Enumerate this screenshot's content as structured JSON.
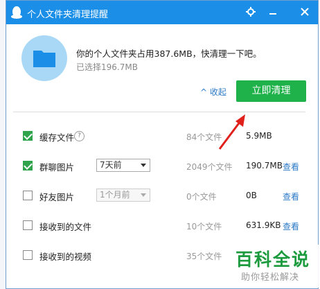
{
  "window": {
    "title": "个人文件夹清理提醒",
    "gear_icon": "gear-icon",
    "minimize_icon": "minimize-icon",
    "close_icon": "close-icon"
  },
  "summary": {
    "main_text": "你的个人文件夹占用387.6MB，快清理一下吧。",
    "selected_text": "已选择196.7MB"
  },
  "actions": {
    "collapse_label": "收起",
    "clean_label": "立即清理"
  },
  "items": [
    {
      "label": "缓存文件",
      "checked": true,
      "count": "84个文件",
      "size": "5.9MB",
      "view": ""
    },
    {
      "label": "群聊图片",
      "checked": true,
      "select": "7天前",
      "count": "2049个文件",
      "size": "190.7MB",
      "view": "查看"
    },
    {
      "label": "好友图片",
      "checked": false,
      "select": "1个月前",
      "count": "0个文件",
      "size": "0B",
      "view": "查看"
    },
    {
      "label": "接收到的文件",
      "checked": false,
      "count": "10个文件",
      "size": "631.9KB",
      "view": "查看"
    },
    {
      "label": "接收到的视频",
      "checked": false,
      "count": "35个文件",
      "size": "",
      "view": ""
    }
  ],
  "watermark": {
    "main": "百科全说",
    "sub": "助你轻松解决"
  },
  "colors": {
    "titlebar": "#1b8fe8",
    "clean_button": "#1fb24a",
    "link": "#2b7ac7"
  }
}
